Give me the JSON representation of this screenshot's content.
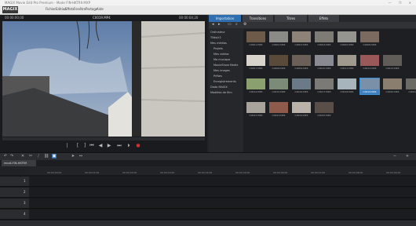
{
  "window": {
    "title": "MAGIX Movie Edit Pro Premium - Mode FIN-HKTR9.MXP",
    "controls": "— ❐ ✕"
  },
  "menu": {
    "logo": "MAGIX",
    "items": [
      "Fichier",
      "Edition",
      "Effets",
      "Fenêtre",
      "Partage",
      "Aide"
    ]
  },
  "preview": {
    "time_left": "00:00:00;00",
    "title": "C0019.MP4",
    "time_right": "00:00:04;20"
  },
  "transport": {
    "buttons": [
      "⎸",
      "[",
      "]",
      "⏮",
      "◀",
      "▶",
      "⏭",
      "⏵",
      "●"
    ]
  },
  "pool": {
    "tabs": [
      "Importation",
      "Transitions",
      "Titres",
      "Effets"
    ],
    "active_tab": "Importation",
    "tree": [
      "Ordinateur",
      "Tilda/c2",
      "Mes médias",
      "Projets",
      "Mes vidéos",
      "Ma musique",
      "MovieShow Medie",
      "Mes images",
      "Prêtes",
      "Enregistrements",
      "Dada MAGIX",
      "Modèles de film"
    ],
    "clips": [
      {
        "name": "C0001.MP4",
        "color": "#6e5a48"
      },
      {
        "name": "C0002.MP4",
        "color": "#8a8a86"
      },
      {
        "name": "C0003.MP4",
        "color": "#8c8278"
      },
      {
        "name": "C0004.MP4",
        "color": "#7e7a74"
      },
      {
        "name": "C0005.MP4",
        "color": "#95958f"
      },
      {
        "name": "C0006.MP4",
        "color": "#7a6a60"
      },
      {
        "name": "C0007.MP4",
        "color": "#d8d4cc"
      },
      {
        "name": "C0008.MP4",
        "color": "#5a4a3a"
      },
      {
        "name": "C0009.MP4",
        "color": "#6a6058"
      },
      {
        "name": "C0010.MP4",
        "color": "#8a8a92"
      },
      {
        "name": "C0011.MP4",
        "color": "#a09a8e"
      },
      {
        "name": "C0012.MP4",
        "color": "#9a5858"
      },
      {
        "name": "C0013.MP4",
        "color": "#605c58"
      },
      {
        "name": "C0014.MP4",
        "color": "#8aa06e"
      },
      {
        "name": "C0015.MP4",
        "color": "#7c8a78"
      },
      {
        "name": "C0016.MP4",
        "color": "#6a7a86"
      },
      {
        "name": "C0017.MP4",
        "color": "#7c7a76"
      },
      {
        "name": "C0018.MP4",
        "color": "#a8b4bc"
      },
      {
        "name": "C0019.MP4",
        "color": "#7a90a8"
      },
      {
        "name": "C0020.MP4",
        "color": "#8a7e6e"
      },
      {
        "name": "C0021.MP4",
        "color": "#6c6a64"
      },
      {
        "name": "C0022.MP4",
        "color": "#a8a49c"
      },
      {
        "name": "C0023.MP4",
        "color": "#8e5a4c"
      },
      {
        "name": "C0024.MP4",
        "color": "#b8b2a8"
      },
      {
        "name": "C0025.MP4",
        "color": "#5a4e48"
      }
    ],
    "selected_clip": "C0019.MP4"
  },
  "timeline": {
    "tab": "recall-FIN-HKTR9",
    "ticks": [
      "00:00:00;00",
      "00:00:01;00",
      "00:00:02;00",
      "00:00:03;00",
      "00:00:04;00",
      "00:00:05;00",
      "00:00:06;00",
      "00:00:07;00",
      "00:00:08;00",
      "00:00:09;00"
    ],
    "tracks": [
      "1",
      "2",
      "3",
      "4"
    ]
  },
  "colors": {
    "accent": "#2f6fb0",
    "sky": "#7d95b4",
    "wall": "#c9c7bf"
  }
}
